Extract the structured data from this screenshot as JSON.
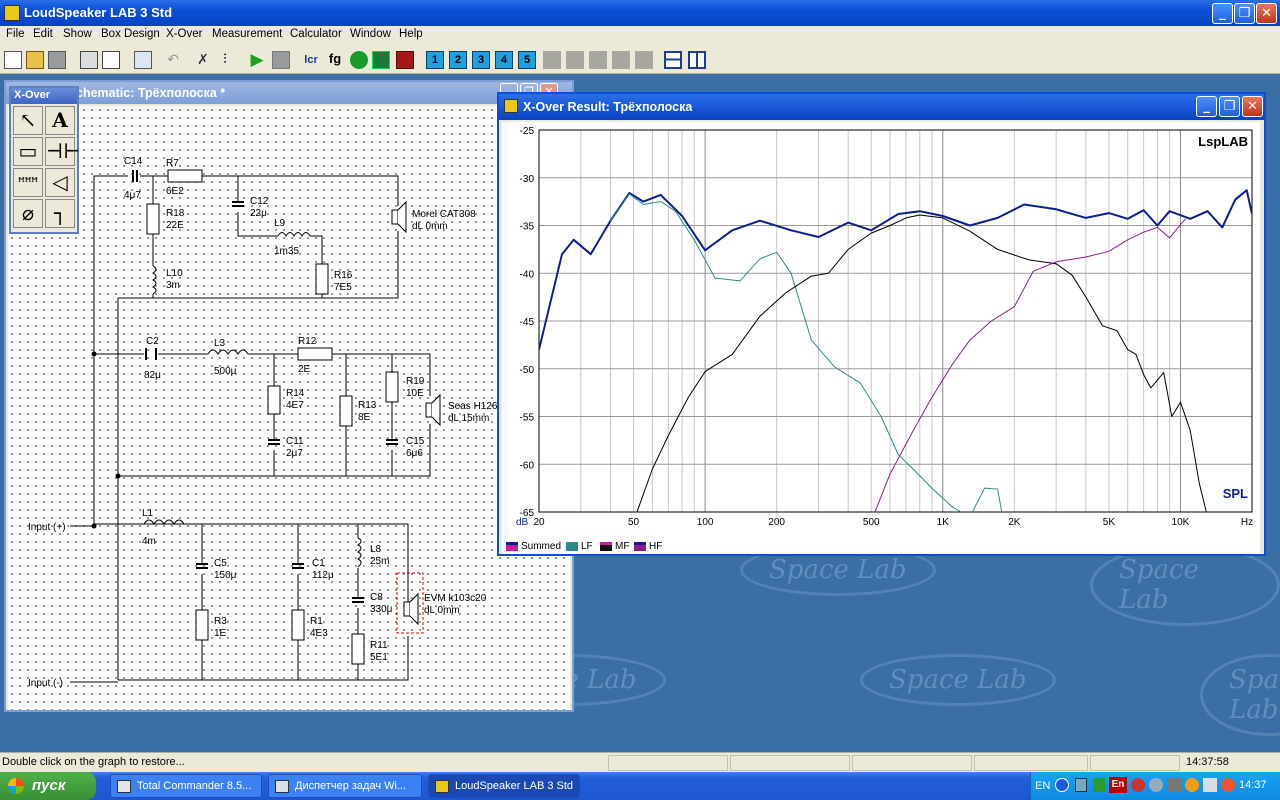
{
  "app": {
    "title": "LoudSpeaker LAB 3 Std"
  },
  "menu": [
    "File",
    "Edit",
    "Show",
    "Box Design",
    "X-Over",
    "Measurement",
    "Calculator",
    "Window",
    "Help"
  ],
  "toolbar": {
    "text_fg": "fg",
    "numbered": [
      "1",
      "2",
      "3",
      "4",
      "5"
    ]
  },
  "schematic": {
    "title": "X-Over Schematic: Трёхполоска *",
    "title_visible": "chematic: Трёхполоска *",
    "labels": {
      "C14": "C14",
      "C14v": "4μ7",
      "R7": "R7",
      "R7v": "6E2",
      "R18": "R18",
      "R18v": "22E",
      "C12": "C12",
      "C12v": "22μ",
      "L9": "L9",
      "L9v": "1m35",
      "R16": "R16",
      "R16v": "7E5",
      "L10": "L10",
      "L10v": "3m",
      "HF": "Morel CAT308",
      "HFdl": "dL 0mm",
      "C2": "C2",
      "C2v": "82μ",
      "L3": "L3",
      "L3v": "500μ",
      "R12": "R12",
      "R12v": "2E",
      "R14": "R14",
      "R14v": "4E7",
      "C11": "C11",
      "C11v": "2μ7",
      "R13": "R13",
      "R13v": "8E",
      "R19": "R19",
      "R19v": "10E",
      "C15": "C15",
      "C15v": "6μ6",
      "MF": "Seas H126",
      "MFdl": "dL 15mm",
      "L1": "L1",
      "L1v": "4m",
      "C5": "C5",
      "C5v": "150μ",
      "R3": "R3",
      "R3v": "1E",
      "C1": "C1",
      "C1v": "112μ",
      "R1": "R1",
      "R1v": "4E3",
      "L8": "L8",
      "L8v": "25m",
      "C8": "C8",
      "C8v": "330μ",
      "R11": "R11",
      "R11v": "5E1",
      "LF": "EVM k103c20",
      "LFdl": "dL 0mm",
      "inp": "Input (+)",
      "inn": "Input (-)"
    }
  },
  "palette": {
    "title": "X-Over"
  },
  "xover": {
    "title": "X-Over Result: Трёхполоска",
    "brand": "LspLAB",
    "mode": "SPL",
    "db_label": "dB",
    "hz_label": "Hz"
  },
  "chart_data": {
    "type": "line",
    "xscale": "log",
    "xlim": [
      20,
      20000
    ],
    "ylim": [
      -65,
      -25
    ],
    "ylabel": "dB",
    "xlabel": "Hz",
    "grid": true,
    "y_ticks": [
      -25,
      -30,
      -35,
      -40,
      -45,
      -50,
      -55,
      -60,
      -65
    ],
    "x_ticks": [
      {
        "v": 20,
        "l": "20"
      },
      {
        "v": 50,
        "l": "50"
      },
      {
        "v": 100,
        "l": "100"
      },
      {
        "v": 200,
        "l": "200"
      },
      {
        "v": 500,
        "l": "500"
      },
      {
        "v": 1000,
        "l": "1K"
      },
      {
        "v": 2000,
        "l": "2K"
      },
      {
        "v": 5000,
        "l": "5K"
      },
      {
        "v": 10000,
        "l": "10K"
      }
    ],
    "series": [
      {
        "name": "Summed",
        "color": "#0b1f8f",
        "width": 2,
        "points": [
          [
            20,
            -48
          ],
          [
            25,
            -38
          ],
          [
            28,
            -36.5
          ],
          [
            33,
            -38
          ],
          [
            40,
            -34.5
          ],
          [
            48,
            -31.6
          ],
          [
            55,
            -32.5
          ],
          [
            65,
            -31.8
          ],
          [
            80,
            -34
          ],
          [
            100,
            -37.6
          ],
          [
            130,
            -35.5
          ],
          [
            170,
            -34.5
          ],
          [
            230,
            -35.5
          ],
          [
            300,
            -36.2
          ],
          [
            400,
            -34.7
          ],
          [
            500,
            -35.5
          ],
          [
            650,
            -33.8
          ],
          [
            800,
            -33.5
          ],
          [
            1000,
            -34
          ],
          [
            1300,
            -35
          ],
          [
            1700,
            -34.2
          ],
          [
            2200,
            -32.8
          ],
          [
            3000,
            -33.3
          ],
          [
            4000,
            -34.2
          ],
          [
            5000,
            -33.7
          ],
          [
            6000,
            -34.3
          ],
          [
            7000,
            -33.4
          ],
          [
            8000,
            -35
          ],
          [
            9000,
            -33.5
          ],
          [
            11000,
            -34.3
          ],
          [
            13000,
            -33.5
          ],
          [
            15000,
            -35.2
          ],
          [
            17000,
            -32.3
          ],
          [
            19000,
            -31.3
          ],
          [
            20000,
            -33.8
          ]
        ]
      },
      {
        "name": "LF",
        "color": "#2a8c8c",
        "width": 1,
        "points": [
          [
            40,
            -34.5
          ],
          [
            48,
            -31.7
          ],
          [
            55,
            -32.8
          ],
          [
            65,
            -32.5
          ],
          [
            75,
            -33.5
          ],
          [
            90,
            -36.5
          ],
          [
            110,
            -40.5
          ],
          [
            140,
            -40.8
          ],
          [
            170,
            -38.5
          ],
          [
            200,
            -37.8
          ],
          [
            230,
            -40
          ],
          [
            280,
            -47
          ],
          [
            350,
            -49.8
          ],
          [
            450,
            -51.5
          ],
          [
            550,
            -55
          ],
          [
            650,
            -59
          ],
          [
            750,
            -60.5
          ],
          [
            900,
            -62.5
          ],
          [
            1100,
            -64.5
          ],
          [
            1300,
            -65.5
          ],
          [
            1500,
            -62.5
          ],
          [
            1700,
            -62.6
          ],
          [
            1800,
            -66
          ]
        ]
      },
      {
        "name": "MF",
        "color": "#000000",
        "width": 1,
        "points": [
          [
            50,
            -66
          ],
          [
            60,
            -60.5
          ],
          [
            70,
            -57
          ],
          [
            85,
            -53
          ],
          [
            100,
            -50.3
          ],
          [
            130,
            -48.5
          ],
          [
            170,
            -44.5
          ],
          [
            220,
            -42
          ],
          [
            280,
            -40.3
          ],
          [
            330,
            -40
          ],
          [
            400,
            -37.5
          ],
          [
            500,
            -35.8
          ],
          [
            600,
            -35
          ],
          [
            700,
            -34.2
          ],
          [
            800,
            -33.9
          ],
          [
            1000,
            -34.2
          ],
          [
            1300,
            -35.6
          ],
          [
            1700,
            -37.5
          ],
          [
            2300,
            -38.6
          ],
          [
            3000,
            -39
          ],
          [
            3500,
            -40.2
          ],
          [
            4000,
            -42.5
          ],
          [
            4700,
            -45.5
          ],
          [
            5400,
            -46
          ],
          [
            6000,
            -48
          ],
          [
            6500,
            -48.5
          ],
          [
            7000,
            -50.6
          ],
          [
            7500,
            -52
          ],
          [
            8500,
            -50.4
          ],
          [
            9200,
            -55
          ],
          [
            10000,
            -53.5
          ],
          [
            11000,
            -56.5
          ],
          [
            12000,
            -62
          ],
          [
            13000,
            -65.5
          ]
        ]
      },
      {
        "name": "HF",
        "color": "#8c1a8c",
        "width": 1,
        "points": [
          [
            500,
            -66
          ],
          [
            600,
            -61
          ],
          [
            750,
            -56.5
          ],
          [
            900,
            -53
          ],
          [
            1100,
            -49.5
          ],
          [
            1300,
            -47
          ],
          [
            1600,
            -45
          ],
          [
            2000,
            -43.5
          ],
          [
            2400,
            -39.8
          ],
          [
            3000,
            -38.8
          ],
          [
            4000,
            -38.3
          ],
          [
            5000,
            -37.7
          ],
          [
            6000,
            -36.5
          ],
          [
            7000,
            -35.7
          ],
          [
            8000,
            -35.2
          ],
          [
            9000,
            -36.3
          ],
          [
            9700,
            -35.3
          ],
          [
            10500,
            -34.3
          ]
        ]
      }
    ]
  },
  "status": {
    "text": "Double click on the graph to restore...",
    "time": "14:37:58"
  },
  "taskbar": {
    "start": "пуск",
    "tasks": [
      "Total Commander 8.5...",
      "Диспетчер задач Wi...",
      "LoudSpeaker LAB 3 Std"
    ],
    "lang": "EN",
    "clock": "14:37",
    "tray_en": "En"
  },
  "watermark": "Space Lab"
}
